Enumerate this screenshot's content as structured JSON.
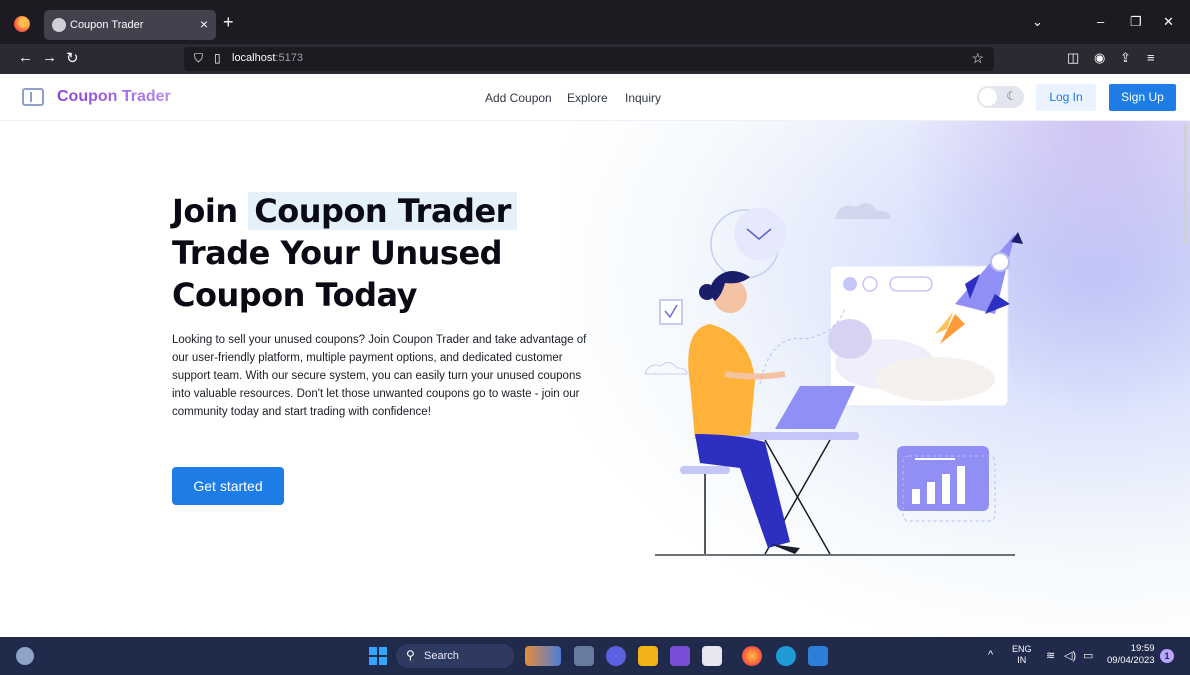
{
  "browser": {
    "tab_title": "Coupon Trader",
    "url_host": "localhost",
    "url_port": ":5173"
  },
  "site": {
    "brand": "Coupon Trader",
    "nav": [
      "Add Coupon",
      "Explore",
      "Inquiry"
    ],
    "login_label": "Log In",
    "signup_label": "Sign Up"
  },
  "hero": {
    "title_prefix": "Join",
    "title_highlight": "Coupon Trader",
    "title_line2": "Trade Your Unused",
    "title_line3": "Coupon Today",
    "description": "Looking to sell your unused coupons? Join Coupon Trader and take advantage of our user-friendly platform, multiple payment options, and dedicated customer support team. With our secure system, you can easily turn your unused coupons into valuable resources. Don't let those unwanted coupons go to waste - join our community today and start trading with confidence!",
    "cta_label": "Get started"
  },
  "taskbar": {
    "search_label": "Search",
    "lang_line1": "ENG",
    "lang_line2": "IN",
    "time": "19:59",
    "date": "09/04/2023",
    "notification_count": "1"
  },
  "colors": {
    "brand_purple": "#8a52e0",
    "primary_blue": "#1d7ce6",
    "highlight_bg": "#e4f1fb"
  }
}
